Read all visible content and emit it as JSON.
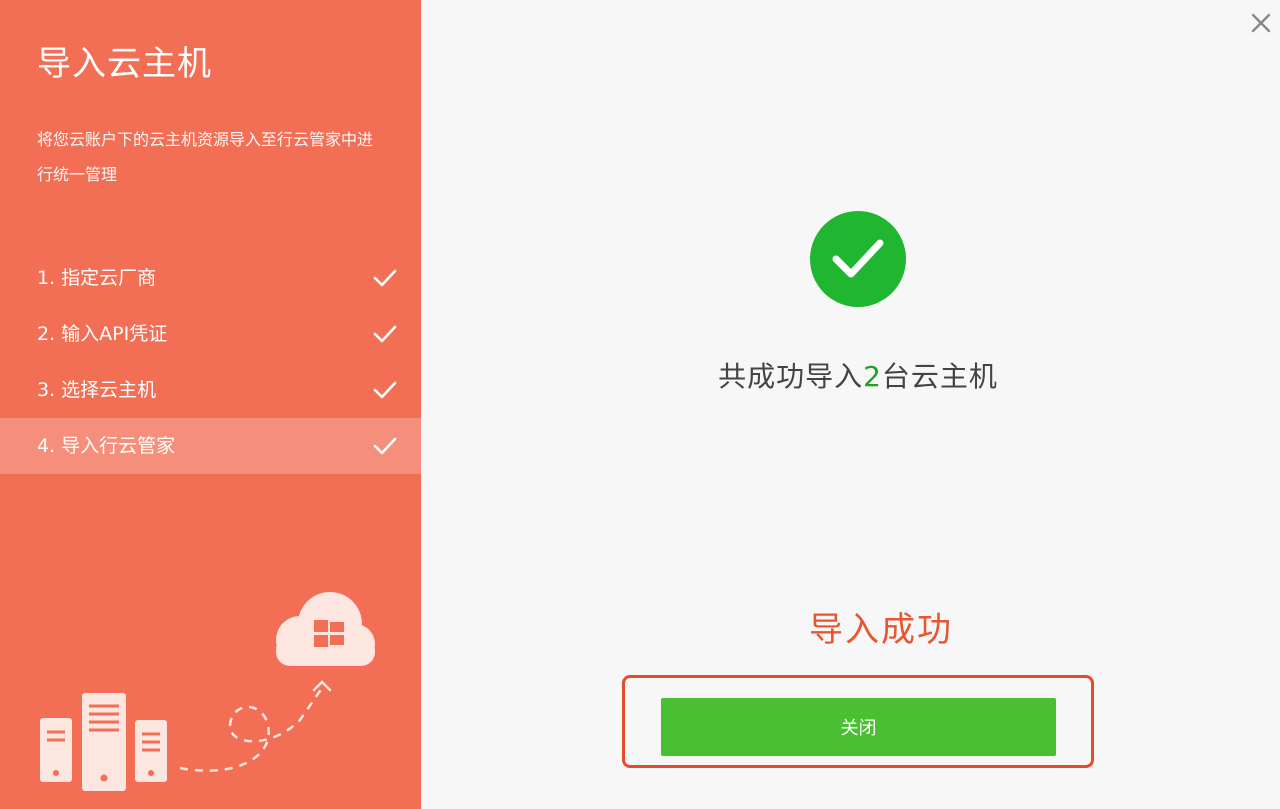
{
  "sidebar": {
    "title": "导入云主机",
    "description": "将您云账户下的云主机资源导入至行云管家中进行统一管理",
    "steps": [
      {
        "label": "1. 指定云厂商",
        "completed": true
      },
      {
        "label": "2. 输入API凭证",
        "completed": true
      },
      {
        "label": "3. 选择云主机",
        "completed": true
      },
      {
        "label": "4. 导入行云管家",
        "completed": true,
        "active": true
      }
    ]
  },
  "main": {
    "result_prefix": "共成功导入",
    "result_count": "2",
    "result_suffix": "台云主机",
    "status_label": "导入成功",
    "close_button_label": "关闭"
  },
  "icons": {
    "window_close": "close-icon",
    "success": "check-circle-icon",
    "step_done": "check-icon"
  },
  "colors": {
    "sidebar_bg": "#f26f55",
    "success_green": "#21b630",
    "button_green": "#4abf32",
    "count_green": "#1fa31f",
    "status_red": "#e8552f",
    "highlight_border": "#e84b2c"
  }
}
